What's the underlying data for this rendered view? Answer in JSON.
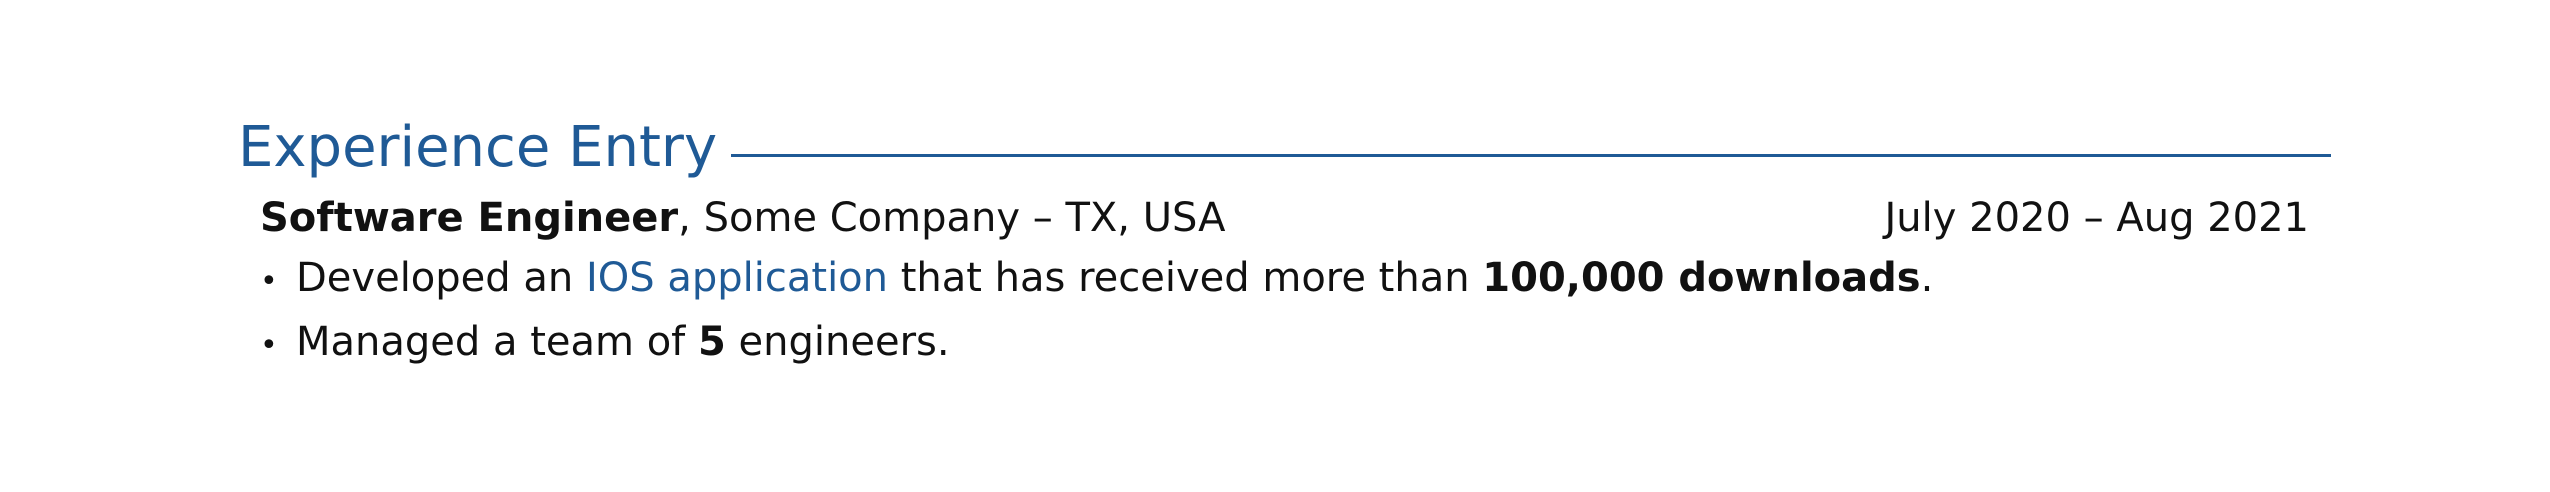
{
  "section": {
    "title": "Experience Entry"
  },
  "entry": {
    "role": "Software Engineer",
    "separator": ", ",
    "company_location": "Some Company – TX, USA",
    "dates": "July 2020 – Aug 2021"
  },
  "bullets": [
    {
      "dot": "•",
      "part1": "Developed an ",
      "link_text": "IOS application",
      "part2": " that has received more than ",
      "bold_text": "100,000 downloads",
      "part3": "."
    },
    {
      "dot": "•",
      "part1": "Managed a team of ",
      "bold_text": "5",
      "part2": " engineers."
    }
  ],
  "colors": {
    "accent": "#1f5a96",
    "text": "#111111"
  }
}
